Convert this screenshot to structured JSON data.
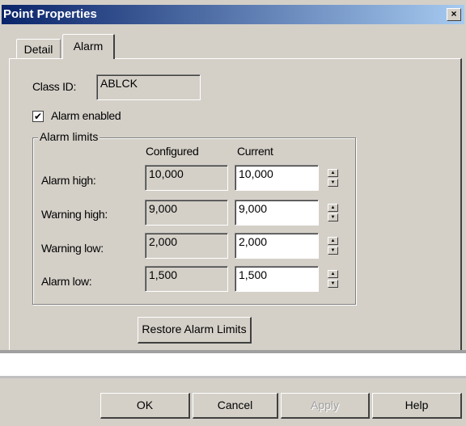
{
  "window": {
    "title": "Point Properties",
    "close_glyph": "×"
  },
  "tabs": [
    "Detail",
    "Alarm"
  ],
  "class_id": {
    "label": "Class ID:",
    "value": "ABLCK"
  },
  "alarm_enabled": {
    "label": "Alarm enabled",
    "checked": true,
    "check_glyph": "✔"
  },
  "alarm_limits": {
    "title": "Alarm limits",
    "col_configured": "Configured",
    "col_current": "Current",
    "rows": [
      {
        "label": "Alarm high:",
        "configured": "10,000",
        "current": "10,000"
      },
      {
        "label": "Warning high:",
        "configured": "9,000",
        "current": "9,000"
      },
      {
        "label": "Warning low:",
        "configured": "2,000",
        "current": "2,000"
      },
      {
        "label": "Alarm low:",
        "configured": "1,500",
        "current": "1,500"
      }
    ]
  },
  "restore_button": "Restore Alarm Limits",
  "buttons": {
    "ok": "OK",
    "cancel": "Cancel",
    "apply": "Apply",
    "help": "Help"
  }
}
